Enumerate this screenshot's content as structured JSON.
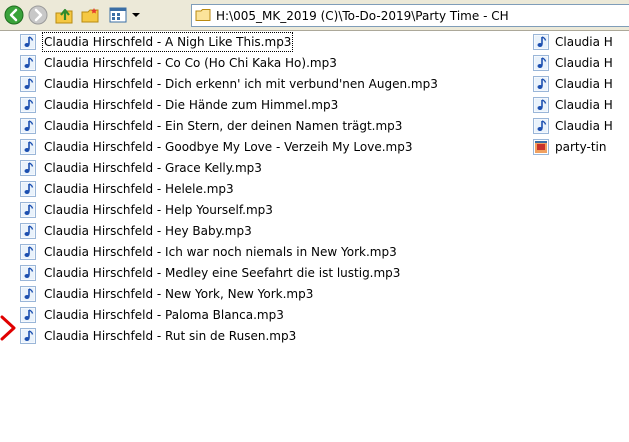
{
  "address": {
    "path": "H:\\005_MK_2019 (C)\\To-Do-2019\\Party Time - CH"
  },
  "toolbar": {
    "icons": [
      "back-icon",
      "forward-icon",
      "up-folder-icon",
      "folders-icon",
      "views-icon",
      "views-dropdown-icon"
    ]
  },
  "files_left": [
    "Claudia Hirschfeld - A Nigh Like This.mp3",
    "Claudia Hirschfeld - Co Co (Ho Chi Kaka Ho).mp3",
    "Claudia Hirschfeld - Dich erkenn' ich mit verbund'nen Augen.mp3",
    "Claudia Hirschfeld - Die Hände zum Himmel.mp3",
    "Claudia Hirschfeld - Ein Stern, der deinen Namen trägt.mp3",
    "Claudia Hirschfeld - Goodbye My Love - Verzeih My Love.mp3",
    "Claudia Hirschfeld - Grace Kelly.mp3",
    "Claudia Hirschfeld - Helele.mp3",
    "Claudia Hirschfeld - Help Yourself.mp3",
    "Claudia Hirschfeld - Hey Baby.mp3",
    "Claudia Hirschfeld - Ich war noch niemals in New York.mp3",
    "Claudia Hirschfeld - Medley eine Seefahrt die ist lustig.mp3",
    "Claudia Hirschfeld - New York, New York.mp3",
    "Claudia Hirschfeld - Paloma Blanca.mp3",
    "Claudia Hirschfeld - Rut sin de Rusen.mp3"
  ],
  "files_right": [
    "Claudia H",
    "Claudia H",
    "Claudia H",
    "Claudia H",
    "Claudia H",
    "party-tin"
  ],
  "colors": {
    "toolbar_bg": "#ece9d8",
    "back_green": "#3aa23a",
    "arrow_red": "#e00000",
    "folder_yellow": "#f5c842"
  }
}
